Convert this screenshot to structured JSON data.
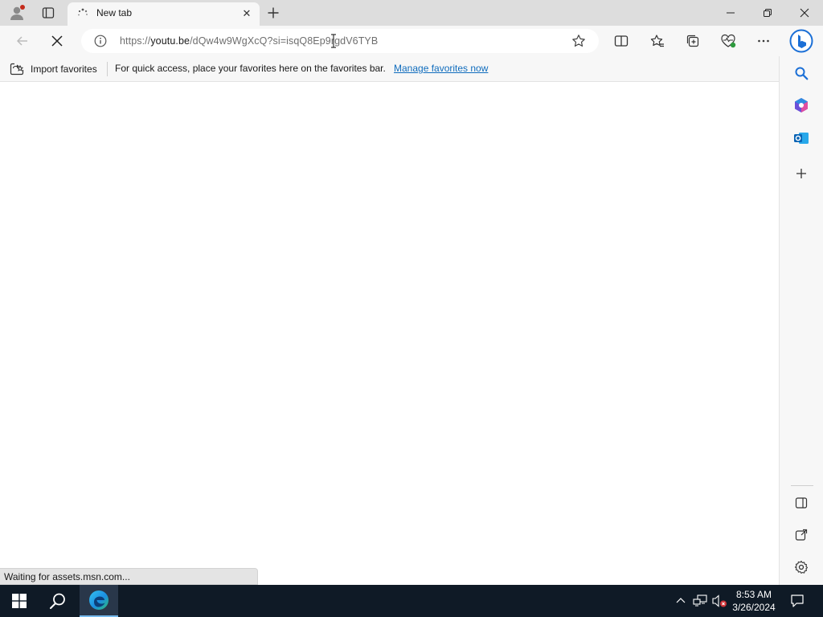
{
  "tab": {
    "title": "New tab",
    "close_glyph": "✕"
  },
  "window_controls": {
    "minimize": "—",
    "restore": "❐",
    "close": "✕"
  },
  "address": {
    "url_prefix": "https://",
    "url_host": "youtu.be",
    "url_rest": "/dQw4w9WgXcQ?si=isqQ8Ep9rgdV6TYB"
  },
  "favorites_bar": {
    "import_label": "Import favorites",
    "message": "For quick access, place your favorites here on the favorites bar.",
    "manage_link": "Manage favorites now"
  },
  "status_text": "Waiting for assets.msn.com...",
  "clock": {
    "time": "8:53 AM",
    "date": "3/26/2024"
  },
  "colors": {
    "bing_blue": "#1b6fd6",
    "link_blue": "#0f6cbd",
    "taskbar_bg": "#0f1a26"
  },
  "icons": {
    "profile": "profile-icon",
    "workspaces": "tab-actions-icon",
    "loading": "loading-icon",
    "new_tab": "plus-icon",
    "back": "back-arrow-icon",
    "stop": "stop-icon",
    "site_info": "info-icon",
    "favorite": "star-icon",
    "split_screen": "split-screen-icon",
    "favorites": "favorites-icon",
    "collections": "collections-icon",
    "browser_essentials": "heart-pulse-icon",
    "more": "ellipsis-icon",
    "copilot": "bing-icon",
    "search": "search-icon",
    "office": "office-icon",
    "outlook": "outlook-icon",
    "add_sidebar": "plus-icon",
    "hide_sidebar": "sidebar-icon",
    "open_external": "external-link-icon",
    "settings": "gear-icon",
    "start": "windows-start-icon",
    "taskbar_search": "search-icon",
    "edge": "edge-icon",
    "tray_chevron": "chevron-up-icon",
    "network": "network-icon",
    "volume_muted": "volume-muted-icon",
    "notifications": "notification-icon"
  }
}
